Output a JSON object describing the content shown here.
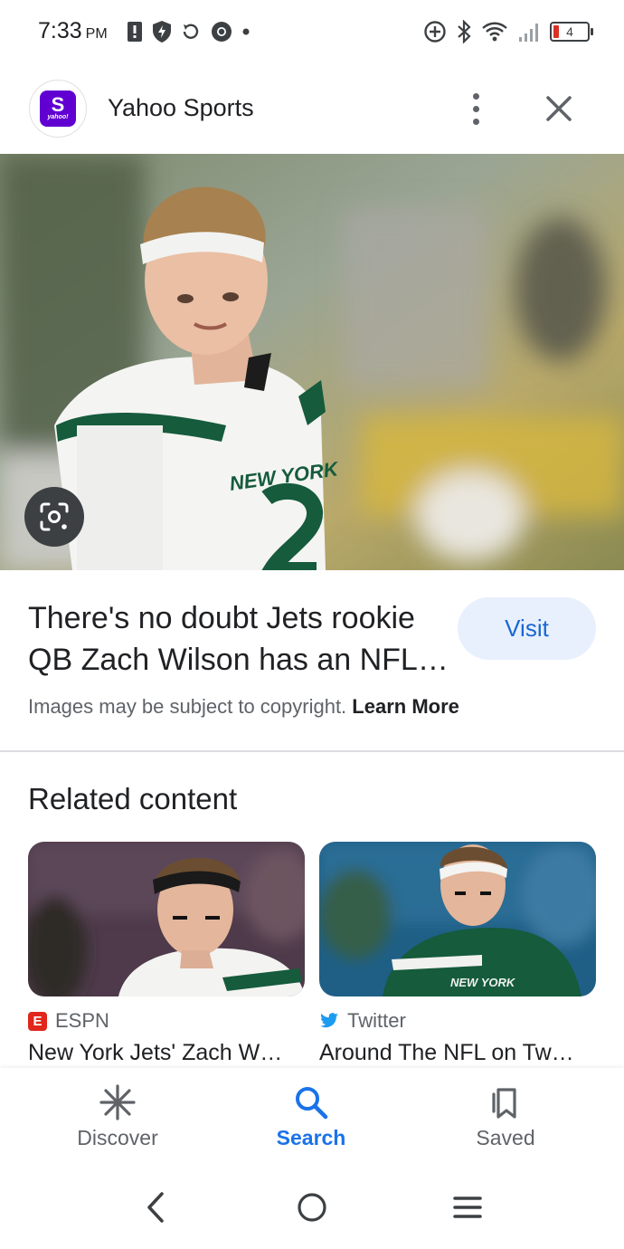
{
  "status_bar": {
    "time": "7:33",
    "ampm": "PM",
    "battery": "4"
  },
  "header": {
    "site_name": "Yahoo Sports",
    "logo_letter": "S",
    "logo_word": "yahoo!"
  },
  "result": {
    "title": "There's no doubt Jets rookie QB Zach Wilson has an NFL…",
    "visit_label": "Visit",
    "copyright_text": "Images may be subject to copyright.",
    "learn_more": "Learn More"
  },
  "related": {
    "heading": "Related content",
    "cards": [
      {
        "source": "ESPN",
        "source_icon": "espn-icon",
        "headline": "New York Jets' Zach W…"
      },
      {
        "source": "Twitter",
        "source_icon": "twitter-bird-icon",
        "headline": "Around The NFL on Tw…"
      }
    ]
  },
  "bottom_nav": {
    "items": [
      {
        "label": "Discover",
        "icon": "asterisk-icon",
        "active": false
      },
      {
        "label": "Search",
        "icon": "search-icon",
        "active": true
      },
      {
        "label": "Saved",
        "icon": "bookmarks-icon",
        "active": false
      }
    ]
  },
  "colors": {
    "accent": "#1a73e8",
    "visit_bg": "#e8f0fe",
    "yahoo_purple": "#6001d2",
    "jets_green": "#125740",
    "espn_red": "#e1261c",
    "twitter_blue": "#1d9bf0"
  }
}
